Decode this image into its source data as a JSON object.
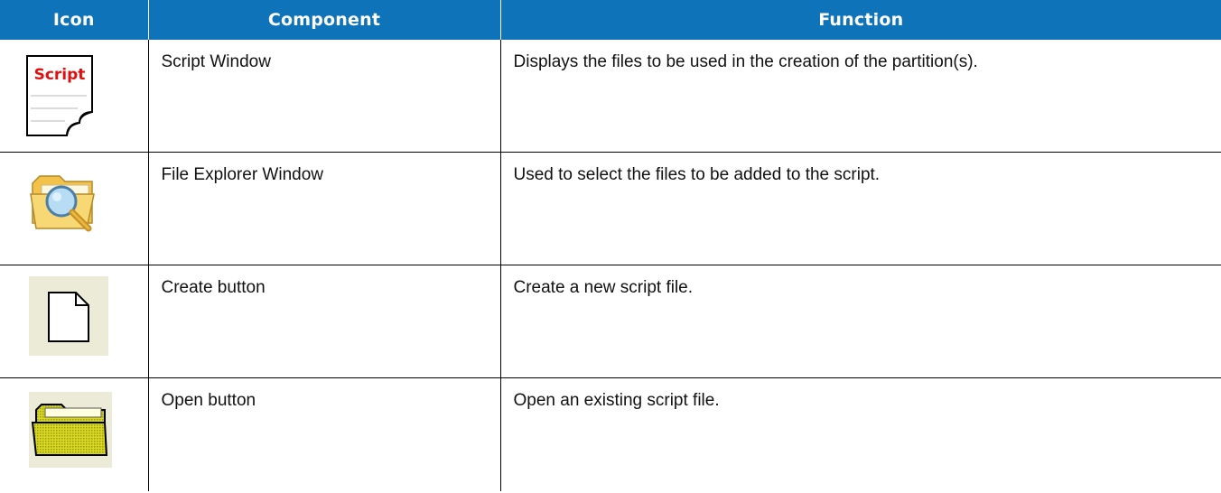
{
  "table": {
    "headers": [
      "Icon",
      "Component",
      "Function"
    ],
    "rows": [
      {
        "icon": "script-window-icon",
        "icon_text": "Script",
        "component": "Script Window",
        "function": "Displays the files to be used in the creation of the partition(s)."
      },
      {
        "icon": "file-explorer-folder-search-icon",
        "component": "File Explorer Window",
        "function": "Used to select the files to be added to the script."
      },
      {
        "icon": "new-document-icon",
        "component": "Create button",
        "function": "Create a new script file."
      },
      {
        "icon": "open-folder-icon",
        "component": "Open button",
        "function": "Open an existing script file."
      }
    ]
  },
  "colors": {
    "header_background": "#0e73b9",
    "header_text": "#ffffff",
    "script_label": "#e01010",
    "folder_yellow": "#f6cf55",
    "button_background": "#ecebd8",
    "open_folder_fill": "#cfcf1a"
  }
}
